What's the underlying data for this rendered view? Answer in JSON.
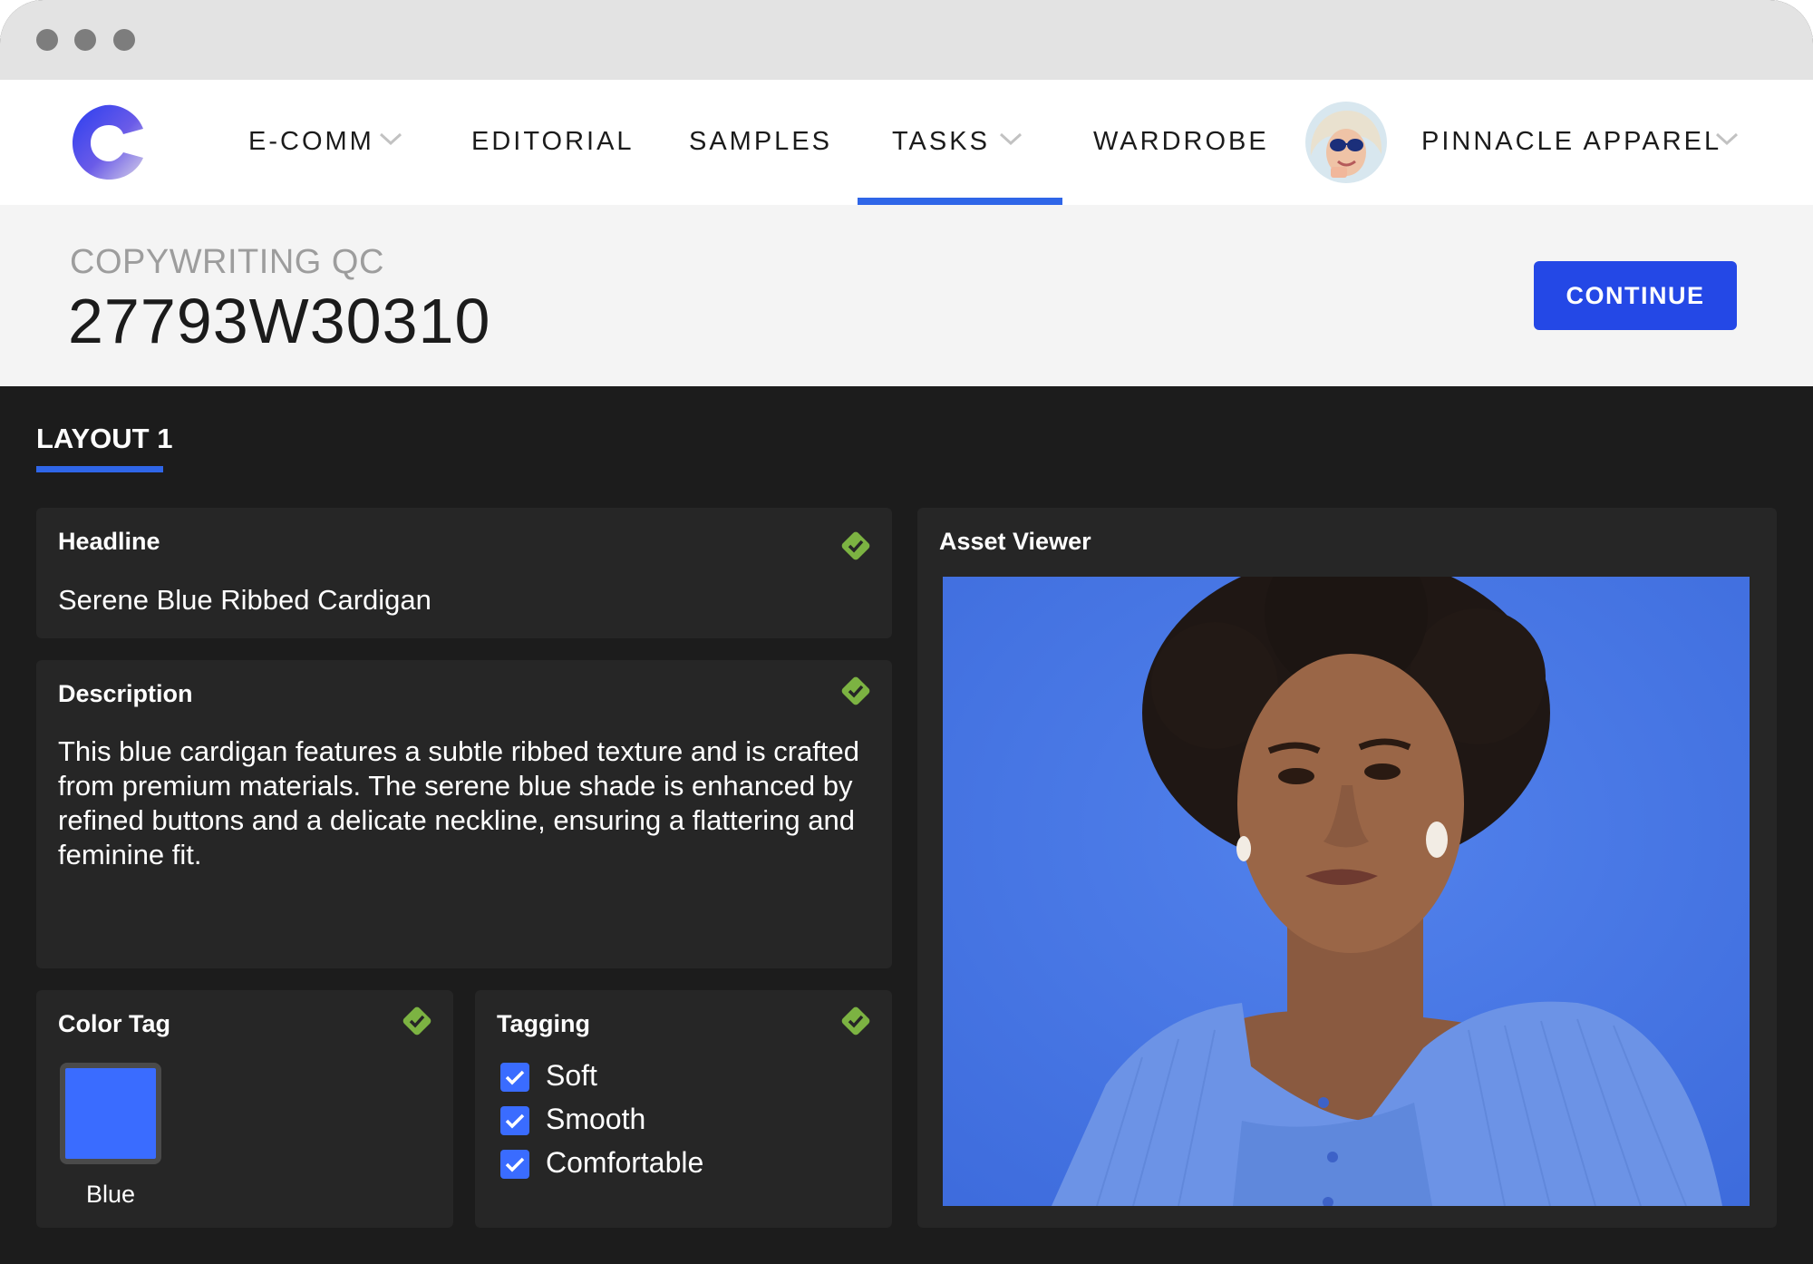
{
  "nav": {
    "items": [
      {
        "label": "E-COMM",
        "has_dropdown": true
      },
      {
        "label": "EDITORIAL",
        "has_dropdown": false
      },
      {
        "label": "SAMPLES",
        "has_dropdown": false
      },
      {
        "label": "TASKS",
        "has_dropdown": true,
        "active": true
      },
      {
        "label": "WARDROBE",
        "has_dropdown": false
      }
    ],
    "account_name": "PINNACLE APPAREL"
  },
  "task": {
    "type_label": "COPYWRITING QC",
    "id": "27793W30310",
    "continue_label": "CONTINUE"
  },
  "layout_tab": {
    "label": "LAYOUT 1"
  },
  "headline": {
    "title": "Headline",
    "value": "Serene Blue Ribbed Cardigan"
  },
  "description": {
    "title": "Description",
    "value": "This blue cardigan features a subtle ribbed texture and is crafted from premium materials. The serene blue shade is enhanced by refined buttons and a delicate neckline, ensuring a flattering and feminine fit."
  },
  "color_tag": {
    "title": "Color Tag",
    "color_name": "Blue",
    "color_hex": "#3a6cff"
  },
  "tagging": {
    "title": "Tagging",
    "tags": [
      {
        "label": "Soft",
        "checked": true
      },
      {
        "label": "Smooth",
        "checked": true
      },
      {
        "label": "Comfortable",
        "checked": true
      }
    ]
  },
  "asset_viewer": {
    "title": "Asset Viewer"
  },
  "colors": {
    "accent": "#2448e6",
    "tab_underline": "#2f66e8",
    "check_green": "#7cb342",
    "dark_bg": "#1c1c1c",
    "panel_bg": "#262626"
  }
}
